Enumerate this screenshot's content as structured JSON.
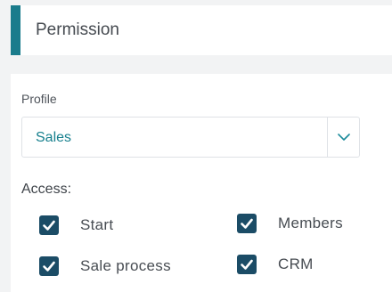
{
  "header": {
    "title": "Permission"
  },
  "profile": {
    "label": "Profile",
    "selected": "Sales",
    "chevron_icon": "chevron-down-icon"
  },
  "access": {
    "label": "Access:",
    "items": [
      {
        "label": "Start",
        "checked": true
      },
      {
        "label": "Members",
        "checked": true
      },
      {
        "label": "Sale process",
        "checked": true
      },
      {
        "label": "CRM",
        "checked": true
      }
    ]
  },
  "colors": {
    "accent": "#1a7c8c",
    "select_text": "#17808e",
    "checkbox_fill": "#1b4c66",
    "page_background": "#f2f3f4"
  }
}
